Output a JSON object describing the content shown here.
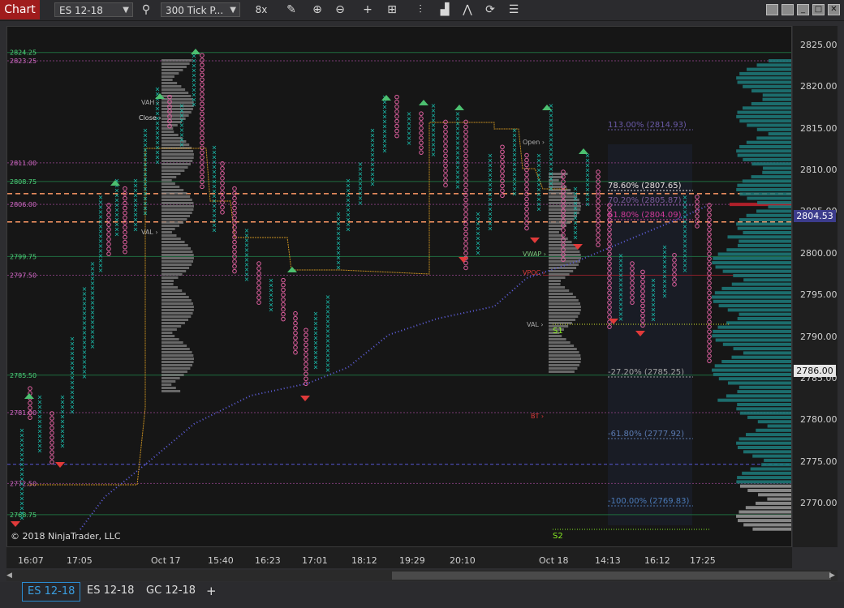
{
  "toolbar": {
    "title": "Chart",
    "instrument": "ES 12-18",
    "interval": "300 Tick P...",
    "icons": [
      "search-icon",
      "crosshair-off-icon",
      "draw-pencil-icon",
      "zoom-in-icon",
      "zoom-out-icon",
      "crosshair-icon",
      "data-box-icon",
      "bar-type-icon",
      "strategy-icon",
      "indicator-icon",
      "refresh-icon",
      "properties-icon"
    ]
  },
  "chart": {
    "copyright": "© 2018 NinjaTrader, LLC",
    "yaxis_labels": [
      "2825.00",
      "2820.00",
      "2815.00",
      "2810.00",
      "2805.00",
      "2800.00",
      "2795.00",
      "2790.00",
      "2785.00",
      "2780.00",
      "2775.00",
      "2770.00"
    ],
    "price_boxes": [
      {
        "label": "2804.53",
        "color": "#3c3c8c"
      },
      {
        "label": "2786.00",
        "color": "#e6e6e6"
      }
    ],
    "level_labels": [
      {
        "text": "2824.25",
        "color": "#4cd47a"
      },
      {
        "text": "2823.25",
        "color": "#d46ac8"
      },
      {
        "text": "2811.00",
        "color": "#d46ac8"
      },
      {
        "text": "2808.75",
        "color": "#4cd47a"
      },
      {
        "text": "2806.00",
        "color": "#d46ac8"
      },
      {
        "text": "2799.75",
        "color": "#4cd47a"
      },
      {
        "text": "2797.50",
        "color": "#d46ac8"
      },
      {
        "text": "2785.50",
        "color": "#4cd47a"
      },
      {
        "text": "2781.00",
        "color": "#d46ac8"
      },
      {
        "text": "2772.50",
        "color": "#d46ac8"
      },
      {
        "text": "2768.75",
        "color": "#4cd47a"
      }
    ],
    "profile_labels": [
      "VAH",
      "Close",
      "VAL",
      "Open",
      "VWAP",
      "VPOC",
      "VAL",
      "BT"
    ],
    "fib_labels": [
      "113.00% (2814.93)",
      "78.60% (2807.65)",
      "70.20% (2805.87)",
      "61.80% (2804.09)",
      "-27.20% (2785.25)",
      "-61.80% (2777.92)",
      "-100.00% (2769.83)"
    ],
    "pivot_labels": [
      "S1",
      "S2"
    ],
    "xaxis_labels": [
      "16:07",
      "17:05",
      "Oct 17",
      "15:40",
      "16:23",
      "17:01",
      "18:12",
      "19:29",
      "20:10",
      "Oct 18",
      "14:13",
      "16:12",
      "17:25"
    ]
  },
  "tabs": [
    "ES 12-18",
    "ES 12-18",
    "GC 12-18",
    "+"
  ]
}
